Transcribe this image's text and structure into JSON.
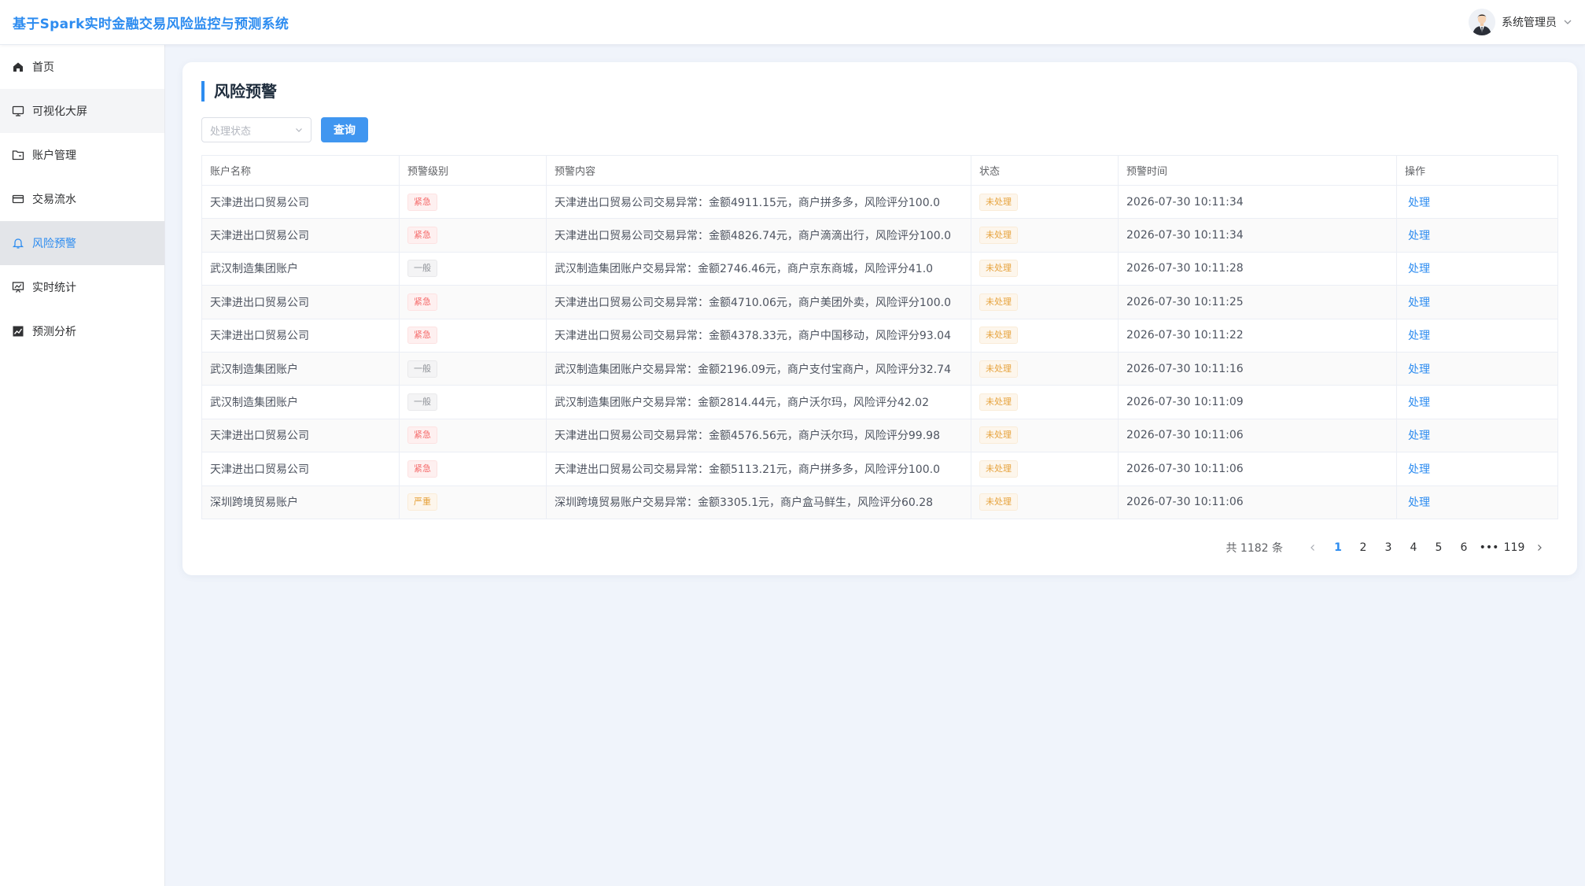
{
  "app": {
    "title": "基于Spark实时金融交易风险监控与预测系统"
  },
  "user": {
    "name": "系统管理员"
  },
  "sidebar": {
    "items": [
      {
        "label": "首页",
        "icon": "home-icon"
      },
      {
        "label": "可视化大屏",
        "icon": "monitor-icon"
      },
      {
        "label": "账户管理",
        "icon": "folder-icon"
      },
      {
        "label": "交易流水",
        "icon": "credit-card-icon"
      },
      {
        "label": "风险预警",
        "icon": "bell-icon",
        "active": true
      },
      {
        "label": "实时统计",
        "icon": "presentation-icon"
      },
      {
        "label": "预测分析",
        "icon": "trend-chart-icon"
      }
    ]
  },
  "main": {
    "title": "风险预警",
    "filter": {
      "placeholder": "处理状态",
      "query_label": "查询"
    },
    "table": {
      "columns": [
        "账户名称",
        "预警级别",
        "预警内容",
        "状态",
        "预警时间",
        "操作"
      ],
      "rows": [
        {
          "account": "天津进出口贸易公司",
          "level": "紧急",
          "level_type": "danger",
          "content": "天津进出口贸易公司交易异常：金额4911.15元，商户拼多多，风险评分100.0",
          "status": "未处理",
          "time": "2026-07-30 10:11:34",
          "action": "处理"
        },
        {
          "account": "天津进出口贸易公司",
          "level": "紧急",
          "level_type": "danger",
          "content": "天津进出口贸易公司交易异常：金额4826.74元，商户滴滴出行，风险评分100.0",
          "status": "未处理",
          "time": "2026-07-30 10:11:34",
          "action": "处理"
        },
        {
          "account": "武汉制造集团账户",
          "level": "一般",
          "level_type": "info",
          "content": "武汉制造集团账户交易异常：金额2746.46元，商户京东商城，风险评分41.0",
          "status": "未处理",
          "time": "2026-07-30 10:11:28",
          "action": "处理"
        },
        {
          "account": "天津进出口贸易公司",
          "level": "紧急",
          "level_type": "danger",
          "content": "天津进出口贸易公司交易异常：金额4710.06元，商户美团外卖，风险评分100.0",
          "status": "未处理",
          "time": "2026-07-30 10:11:25",
          "action": "处理"
        },
        {
          "account": "天津进出口贸易公司",
          "level": "紧急",
          "level_type": "danger",
          "content": "天津进出口贸易公司交易异常：金额4378.33元，商户中国移动，风险评分93.04",
          "status": "未处理",
          "time": "2026-07-30 10:11:22",
          "action": "处理"
        },
        {
          "account": "武汉制造集团账户",
          "level": "一般",
          "level_type": "info",
          "content": "武汉制造集团账户交易异常：金额2196.09元，商户支付宝商户，风险评分32.74",
          "status": "未处理",
          "time": "2026-07-30 10:11:16",
          "action": "处理"
        },
        {
          "account": "武汉制造集团账户",
          "level": "一般",
          "level_type": "info",
          "content": "武汉制造集团账户交易异常：金额2814.44元，商户沃尔玛，风险评分42.02",
          "status": "未处理",
          "time": "2026-07-30 10:11:09",
          "action": "处理"
        },
        {
          "account": "天津进出口贸易公司",
          "level": "紧急",
          "level_type": "danger",
          "content": "天津进出口贸易公司交易异常：金额4576.56元，商户沃尔玛，风险评分99.98",
          "status": "未处理",
          "time": "2026-07-30 10:11:06",
          "action": "处理"
        },
        {
          "account": "天津进出口贸易公司",
          "level": "紧急",
          "level_type": "danger",
          "content": "天津进出口贸易公司交易异常：金额5113.21元，商户拼多多，风险评分100.0",
          "status": "未处理",
          "time": "2026-07-30 10:11:06",
          "action": "处理"
        },
        {
          "account": "深圳跨境贸易账户",
          "level": "严重",
          "level_type": "warn",
          "content": "深圳跨境贸易账户交易异常：金额3305.1元，商户盒马鲜生，风险评分60.28",
          "status": "未处理",
          "time": "2026-07-30 10:11:06",
          "action": "处理"
        }
      ]
    },
    "pagination": {
      "total": "共 1182 条",
      "pages": [
        "1",
        "2",
        "3",
        "4",
        "5",
        "6"
      ],
      "current": "1",
      "ellipsis": "•••",
      "last": "119"
    }
  },
  "colors": {
    "accent": "#2d8cf0",
    "danger": "#f56c6c",
    "warning": "#e6a23c",
    "info": "#909399"
  }
}
